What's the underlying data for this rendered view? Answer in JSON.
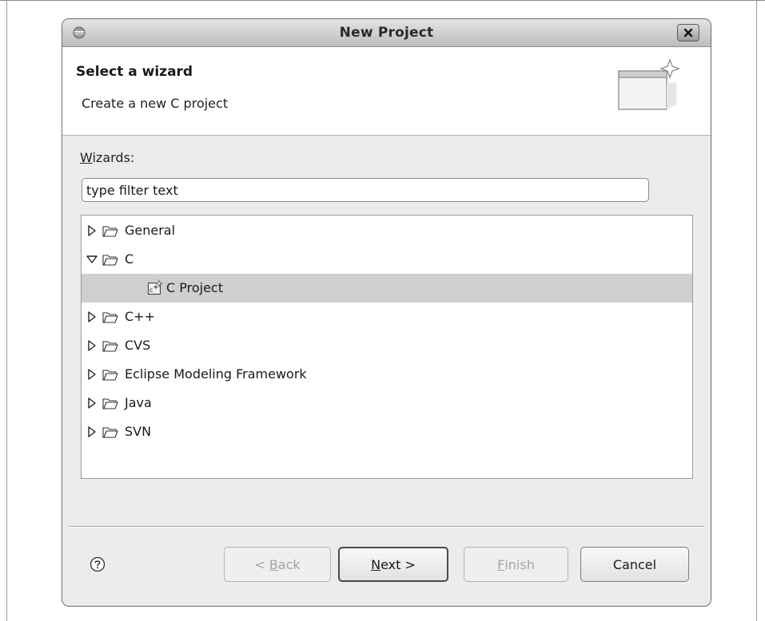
{
  "window": {
    "title": "New Project"
  },
  "header": {
    "title": "Select a wizard",
    "description": "Create a new C project"
  },
  "wizards": {
    "label_mnemonic": "W",
    "label_rest": "izards:",
    "filter_value": "type filter text",
    "filter_placeholder": "type filter text"
  },
  "tree": {
    "items": [
      {
        "label": "General",
        "expanded": false
      },
      {
        "label": "C",
        "expanded": true
      },
      {
        "label": "C Project",
        "child": true,
        "selected": true
      },
      {
        "label": "C++",
        "expanded": false
      },
      {
        "label": "CVS",
        "expanded": false
      },
      {
        "label": "Eclipse Modeling Framework",
        "expanded": false
      },
      {
        "label": "Java",
        "expanded": false
      },
      {
        "label": "SVN",
        "expanded": false
      }
    ]
  },
  "buttons": {
    "back_prefix": "< ",
    "back_mnemonic": "B",
    "back_rest": "ack",
    "next_mnemonic": "N",
    "next_rest": "ext >",
    "finish_mnemonic": "F",
    "finish_rest": "inish",
    "cancel": "Cancel"
  },
  "icons": {
    "window_menu": "window-menu-icon",
    "close": "close-icon",
    "banner": "new-wizard-banner-icon",
    "expander_collapsed": "triangle-right-icon",
    "expander_expanded": "triangle-down-icon",
    "folder": "open-folder-icon",
    "c_project": "c-project-icon",
    "help": "help-icon"
  },
  "colors": {
    "selection": "#cfcfcf",
    "dialog_bg": "#ececec"
  }
}
